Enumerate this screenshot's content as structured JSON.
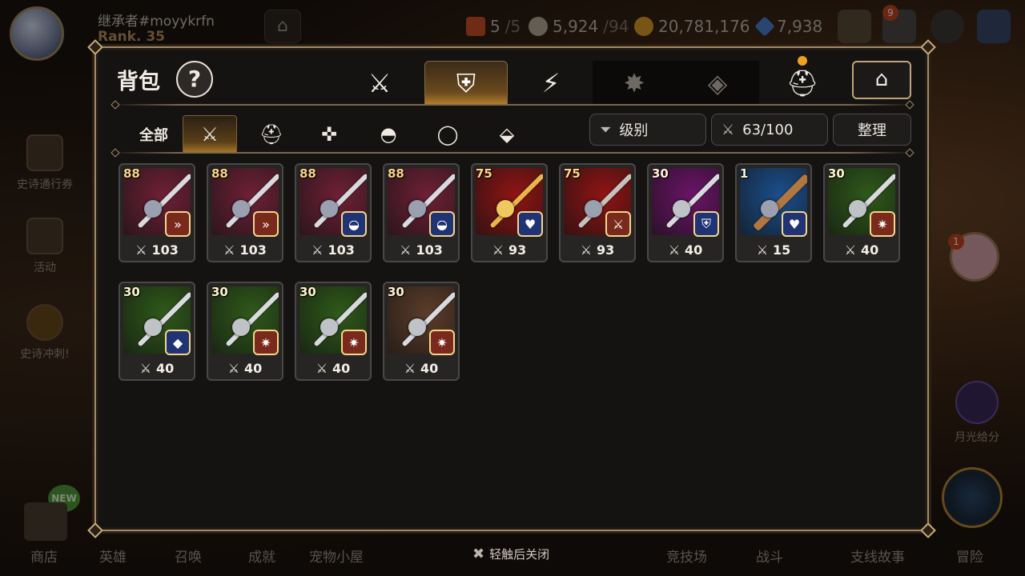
{
  "player": {
    "name": "继承者#moyykrfn",
    "rank": "Rank. 35"
  },
  "resources": [
    {
      "name": "stamina",
      "icon": "keys-icon",
      "value": "5",
      "max": "/5",
      "color": "#c9512a"
    },
    {
      "name": "silver",
      "icon": "dollar-icon",
      "value": "5,924",
      "max": "/94",
      "color": "#b4aa98"
    },
    {
      "name": "gold",
      "icon": "gold-coin-icon",
      "value": "20,781,176",
      "max": "",
      "color": "#d79b2a"
    },
    {
      "name": "gem",
      "icon": "crystal-icon",
      "value": "7,938",
      "max": "",
      "color": "#4c7fd0"
    }
  ],
  "top_icons": {
    "mail_badge": "9"
  },
  "side_menu": [
    {
      "label": "史诗通行券",
      "icon": "pass-icon"
    },
    {
      "label": "活动",
      "icon": "bell-icon"
    },
    {
      "label": "史诗冲刺!",
      "icon": "sprint-icon"
    }
  ],
  "right_side": {
    "moon_label": "月光给分",
    "char_badge": "1"
  },
  "bottom_nav": [
    {
      "label": "商店"
    },
    {
      "label": "英雄"
    },
    {
      "label": "召唤"
    },
    {
      "label": "成就"
    },
    {
      "label": "宠物小屋"
    },
    {
      "label": "竞技场"
    },
    {
      "label": "战斗"
    },
    {
      "label": "支线故事"
    },
    {
      "label": "冒险"
    }
  ],
  "shop_new_badge": "NEW",
  "close_hint": "轻触后关闭",
  "inventory": {
    "title": "背包",
    "help_label": "?",
    "categories": [
      {
        "name": "equipment",
        "icon": "equipment-icon",
        "glyph": "⚔"
      },
      {
        "name": "artifact",
        "icon": "artifact-shield-icon",
        "glyph": "⛨",
        "active": true
      },
      {
        "name": "consumable",
        "icon": "lightning-icon",
        "glyph": "⚡"
      },
      {
        "name": "material",
        "icon": "burst-icon",
        "glyph": "✸",
        "dim": true
      },
      {
        "name": "misc",
        "icon": "cube-icon",
        "glyph": "◈",
        "dim": true
      },
      {
        "name": "special",
        "icon": "backpack-icon",
        "glyph": "⛑"
      }
    ],
    "storage_icon": "storage-icon",
    "subtabs": [
      {
        "label": "全部"
      },
      {
        "icon": "weapon-icon",
        "glyph": "🗡",
        "active": true
      },
      {
        "icon": "helmet-icon",
        "glyph": "⛑"
      },
      {
        "icon": "armor-icon",
        "glyph": "👕"
      },
      {
        "icon": "necklace-icon",
        "glyph": "◓"
      },
      {
        "icon": "ring-icon",
        "glyph": "◯"
      },
      {
        "icon": "boots-icon",
        "glyph": "⬙"
      }
    ],
    "sort_label": "级别",
    "capacity": "63/100",
    "arrange_label": "整理",
    "items": [
      {
        "level": "88",
        "stars": true,
        "bg": "#6e2036",
        "class_icon": "speed-icon",
        "class_color": "#7a2a1c",
        "attack": "103",
        "art": "sword"
      },
      {
        "level": "88",
        "stars": true,
        "bg": "#6e2036",
        "class_icon": "speed-icon",
        "class_color": "#7a2a1c",
        "attack": "103",
        "art": "sword"
      },
      {
        "level": "88",
        "stars": true,
        "bg": "#6e2036",
        "class_icon": "mask-icon",
        "class_color": "#1f3375",
        "attack": "103",
        "art": "sword"
      },
      {
        "level": "88",
        "stars": true,
        "bg": "#6e2036",
        "class_icon": "mask-icon",
        "class_color": "#1f3375",
        "attack": "103",
        "art": "sword"
      },
      {
        "level": "75",
        "stars": true,
        "bg": "#8f1414",
        "class_icon": "heart-icon",
        "class_color": "#1f3375",
        "attack": "93",
        "art": "gold"
      },
      {
        "level": "75",
        "stars": true,
        "bg": "#8f1414",
        "class_icon": "sword-icon",
        "class_color": "#7a2a1c",
        "attack": "93",
        "art": "red"
      },
      {
        "level": "30",
        "stars": false,
        "bg": "#6a1466",
        "class_icon": "shield-icon",
        "class_color": "#1f3375",
        "attack": "40",
        "art": "rapier"
      },
      {
        "level": "1",
        "stars": false,
        "bg": "#1b4f8c",
        "class_icon": "heart-icon",
        "class_color": "#1f3375",
        "attack": "15",
        "art": "club"
      },
      {
        "level": "30",
        "stars": false,
        "bg": "#2f5a1a",
        "class_icon": "star-icon",
        "class_color": "#7a2a1c",
        "attack": "40",
        "art": "rapier"
      },
      {
        "level": "30",
        "stars": false,
        "bg": "#2f5a1a",
        "class_icon": "diamond-icon",
        "class_color": "#1f3375",
        "attack": "40",
        "art": "rapier"
      },
      {
        "level": "30",
        "stars": false,
        "bg": "#2f5a1a",
        "class_icon": "star-icon",
        "class_color": "#7a2a1c",
        "attack": "40",
        "art": "rapier"
      },
      {
        "level": "30",
        "stars": false,
        "bg": "#2f5a1a",
        "class_icon": "star-icon",
        "class_color": "#7a2a1c",
        "attack": "40",
        "art": "rapier"
      },
      {
        "level": "30",
        "stars": false,
        "bg": "#5c3d2a",
        "class_icon": "star-icon",
        "class_color": "#7a2a1c",
        "attack": "40",
        "art": "rapier"
      }
    ]
  }
}
